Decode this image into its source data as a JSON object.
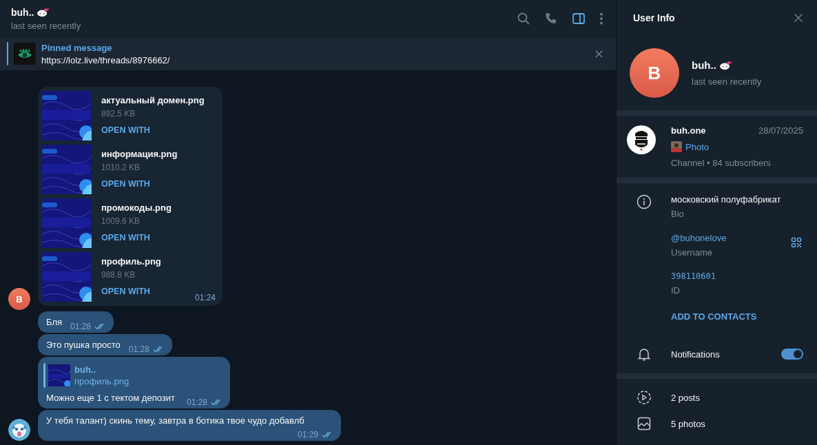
{
  "chat": {
    "header": {
      "name": "buh..",
      "status": "last seen recently"
    },
    "toolbar": [
      {
        "kind": "search",
        "on": false
      },
      {
        "kind": "call",
        "on": false
      },
      {
        "kind": "sidebar",
        "on": true
      },
      {
        "kind": "more",
        "on": false
      }
    ],
    "pinned": {
      "title": "Pinned message",
      "text": "https://lolz.live/threads/8976662/"
    },
    "messages": [
      {
        "kind": "files",
        "outgoing": false,
        "avatar": {
          "kind": "letter",
          "letter": "B"
        },
        "time": "01:24",
        "files": [
          {
            "name": "актуальный домен.png",
            "size": "892.5 KB",
            "action": "OPEN WITH"
          },
          {
            "name": "информация.png",
            "size": "1010.2 KB",
            "action": "OPEN WITH"
          },
          {
            "name": "промокоды.png",
            "size": "1009.6 KB",
            "action": "OPEN WITH"
          },
          {
            "name": "профиль.png",
            "size": "988.8 KB",
            "action": "OPEN WITH"
          }
        ]
      },
      {
        "kind": "text",
        "outgoing": true,
        "text": "Бля",
        "time": "01:28",
        "read": true
      },
      {
        "kind": "text",
        "outgoing": true,
        "text": "Это пушка просто",
        "time": "01:28",
        "read": true
      },
      {
        "kind": "reply",
        "outgoing": true,
        "reply": {
          "author": "buh..",
          "text": "профиль.png"
        },
        "text": "Можно еще 1 с тектом депозит",
        "time": "01:28",
        "read": true
      },
      {
        "kind": "text",
        "outgoing": true,
        "text": "У тебя талант) скинь тему, завтра в ботика твое чудо добавлб",
        "time": "01:29",
        "read": true
      }
    ]
  },
  "info": {
    "title": "User Info",
    "profile": {
      "avatar": "B",
      "name": "buh..",
      "status": "last seen recently"
    },
    "channel": {
      "name": "buh.one",
      "date": "28/07/2025",
      "post": "Photo",
      "meta": "Channel • 84 subscribers"
    },
    "details": [
      {
        "kind": "bio",
        "value": "московский полуфабрикат",
        "label": "Bio"
      },
      {
        "kind": "username",
        "value": "@buhonelove",
        "label": "Username"
      },
      {
        "kind": "id",
        "value": "398110601",
        "label": "ID"
      }
    ],
    "add_contact": "ADD TO CONTACTS",
    "notifications": {
      "label": "Notifications",
      "on": true
    },
    "media": [
      {
        "kind": "posts",
        "label": "2 posts"
      },
      {
        "kind": "photos",
        "label": "5 photos"
      }
    ]
  }
}
